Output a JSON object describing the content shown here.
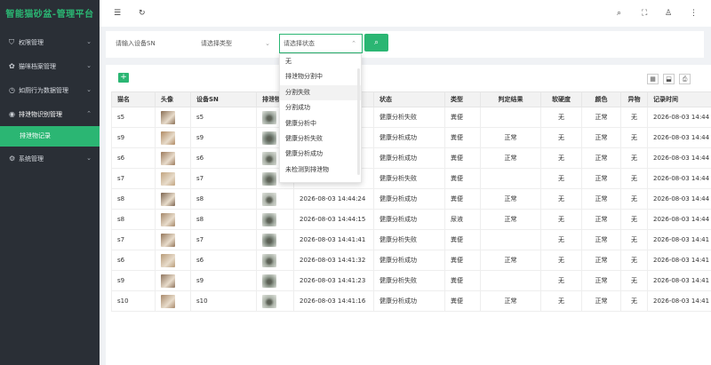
{
  "app_title": "智能猫砂盆-管理平台",
  "sidebar": {
    "items": [
      {
        "label": "权限管理",
        "icon": "shield-icon"
      },
      {
        "label": "猫咪档案管理",
        "icon": "paw-icon"
      },
      {
        "label": "如厕行为数据管理",
        "icon": "clock-icon"
      },
      {
        "label": "排泄物识别管理",
        "icon": "eye-icon"
      },
      {
        "label": "系统管理",
        "icon": "gear-icon"
      }
    ],
    "sub_item": "排泄物记录"
  },
  "filters": {
    "sn_placeholder": "请输入设备SN",
    "type_placeholder": "请选择类型",
    "status_placeholder": "请选择状态"
  },
  "status_options": [
    "无",
    "排泄物分割中",
    "分割失败",
    "分割成功",
    "健康分析中",
    "健康分析失败",
    "健康分析成功",
    "未检测到排泄物"
  ],
  "table": {
    "headers": [
      "猫名",
      "头像",
      "设备SN",
      "排泄物",
      "",
      "状态",
      "类型",
      "判定结果",
      "软硬度",
      "颜色",
      "异物",
      "记录时间"
    ],
    "rows": [
      {
        "cat": "s5",
        "sn": "s5",
        "time": "",
        "status": "健康分析失败",
        "type": "粪便",
        "result": "",
        "hard": "无",
        "color": "正常",
        "foreign": "无",
        "rec": "2026-08-03 14:44"
      },
      {
        "cat": "s9",
        "sn": "s9",
        "time": "",
        "status": "健康分析成功",
        "type": "粪便",
        "result": "正常",
        "hard": "无",
        "color": "正常",
        "foreign": "无",
        "rec": "2026-08-03 14:44"
      },
      {
        "cat": "s6",
        "sn": "s6",
        "time": "",
        "status": "健康分析成功",
        "type": "粪便",
        "result": "正常",
        "hard": "无",
        "color": "正常",
        "foreign": "无",
        "rec": "2026-08-03 14:44"
      },
      {
        "cat": "s7",
        "sn": "s7",
        "time": "",
        "status": "健康分析失败",
        "type": "粪便",
        "result": "",
        "hard": "无",
        "color": "正常",
        "foreign": "无",
        "rec": "2026-08-03 14:44"
      },
      {
        "cat": "s8",
        "sn": "s8",
        "time": "2026-08-03 14:44:24",
        "status": "健康分析成功",
        "type": "粪便",
        "result": "正常",
        "hard": "无",
        "color": "正常",
        "foreign": "无",
        "rec": "2026-08-03 14:44"
      },
      {
        "cat": "s8",
        "sn": "s8",
        "time": "2026-08-03 14:44:15",
        "status": "健康分析成功",
        "type": "尿液",
        "result": "正常",
        "hard": "无",
        "color": "正常",
        "foreign": "无",
        "rec": "2026-08-03 14:44"
      },
      {
        "cat": "s7",
        "sn": "s7",
        "time": "2026-08-03 14:41:41",
        "status": "健康分析失败",
        "type": "粪便",
        "result": "",
        "hard": "无",
        "color": "正常",
        "foreign": "无",
        "rec": "2026-08-03 14:41"
      },
      {
        "cat": "s6",
        "sn": "s6",
        "time": "2026-08-03 14:41:32",
        "status": "健康分析成功",
        "type": "粪便",
        "result": "正常",
        "hard": "无",
        "color": "正常",
        "foreign": "无",
        "rec": "2026-08-03 14:41"
      },
      {
        "cat": "s9",
        "sn": "s9",
        "time": "2026-08-03 14:41:23",
        "status": "健康分析失败",
        "type": "粪便",
        "result": "",
        "hard": "无",
        "color": "正常",
        "foreign": "无",
        "rec": "2026-08-03 14:41"
      },
      {
        "cat": "s10",
        "sn": "s10",
        "time": "2026-08-03 14:41:16",
        "status": "健康分析成功",
        "type": "粪便",
        "result": "正常",
        "hard": "无",
        "color": "正常",
        "foreign": "无",
        "rec": "2026-08-03 14:41"
      }
    ]
  },
  "colors": {
    "accent": "#2bb673",
    "sidebar": "#2a2f36"
  }
}
